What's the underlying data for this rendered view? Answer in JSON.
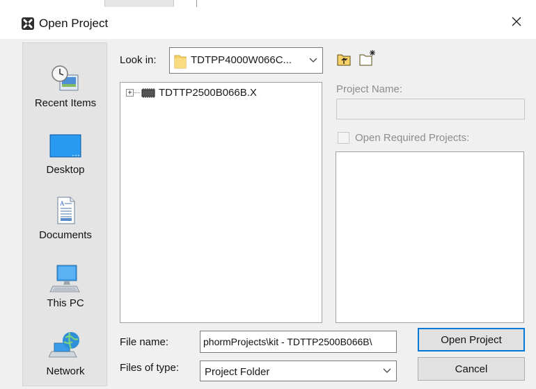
{
  "dialog": {
    "title": "Open Project",
    "close_glyph": "✕",
    "app_icon": "netbeans-logo-icon"
  },
  "places": [
    {
      "label": "Recent Items",
      "icon": "recent-items-icon"
    },
    {
      "label": "Desktop",
      "icon": "desktop-icon"
    },
    {
      "label": "Documents",
      "icon": "documents-icon"
    },
    {
      "label": "This PC",
      "icon": "computer-icon"
    },
    {
      "label": "Network",
      "icon": "network-icon"
    }
  ],
  "look_in": {
    "label": "Look in:",
    "value": "TDTPP4000W066C...",
    "icon": "folder-icon"
  },
  "toolbar": {
    "up_icon": "up-one-level-icon",
    "new_folder_icon": "new-folder-icon"
  },
  "tree": {
    "items": [
      {
        "label": "TDTTP2500B066B.X",
        "expander": "+",
        "icon": "chip-project-icon"
      }
    ]
  },
  "project_info": {
    "name_label": "Project Name:",
    "name_value": "",
    "required_label": "Open Required Projects:",
    "required_checked": false
  },
  "file_name": {
    "label": "File name:",
    "value": "phormProjects\\kit - TDTTP2500B066B\\"
  },
  "files_of_type": {
    "label": "Files of type:",
    "value": "Project Folder"
  },
  "buttons": {
    "open": "Open Project",
    "cancel": "Cancel"
  },
  "colors": {
    "accent": "#0078d7",
    "dialog_bg": "#f0f0f0",
    "places_bg": "#e4e4e4",
    "folder": "#f7d26b"
  }
}
